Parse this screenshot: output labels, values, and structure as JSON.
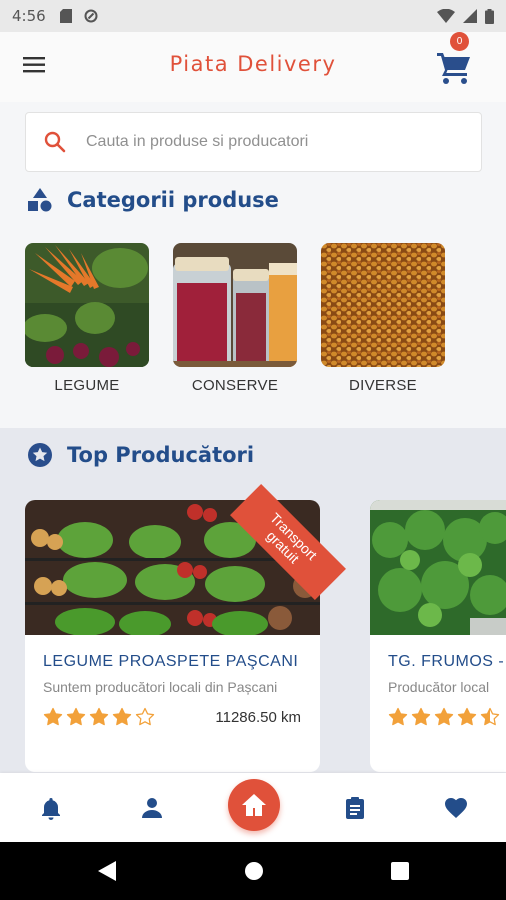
{
  "status_bar": {
    "time": "4:56"
  },
  "app": {
    "title": "Piata Delivery",
    "cart_count": "0"
  },
  "search": {
    "placeholder": "Cauta in produse si producatori"
  },
  "categories_section": {
    "title": "Categorii produse",
    "items": [
      {
        "label": "LEGUME"
      },
      {
        "label": "CONSERVE"
      },
      {
        "label": "DIVERSE"
      }
    ]
  },
  "producers_section": {
    "title": "Top Producători",
    "items": [
      {
        "name": "LEGUME PROASPETE PAŞCANI",
        "description": "Suntem producători locali din Pașcani",
        "rating": 4,
        "distance": "11286.50 km",
        "ribbon_line1": "Transport",
        "ribbon_line2": "gratuit"
      },
      {
        "name": "TG. FRUMOS - ",
        "description": "Producător local",
        "rating": 4.5
      }
    ]
  },
  "colors": {
    "accent": "#e0513a",
    "primary": "#234d8a",
    "star": "#f2a13a"
  }
}
